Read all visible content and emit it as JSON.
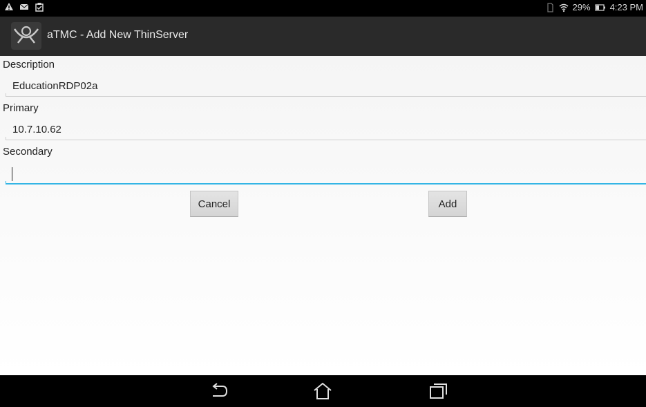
{
  "status_bar": {
    "left_icons": [
      "warning-icon",
      "mail-icon",
      "clipboard-icon"
    ],
    "right_icons": [
      "sim-icon",
      "wifi-icon",
      "battery-icon"
    ],
    "battery_percent": "29%",
    "time": "4:23 PM"
  },
  "action_bar": {
    "title": "aTMC - Add New ThinServer",
    "logo_icon": "atmc-logo-icon"
  },
  "form": {
    "description": {
      "label": "Description",
      "value": "EducationRDP02a"
    },
    "primary": {
      "label": "Primary",
      "value": "10.7.10.62"
    },
    "secondary": {
      "label": "Secondary",
      "value": ""
    }
  },
  "buttons": {
    "cancel": "Cancel",
    "add": "Add"
  },
  "nav_bar": {
    "icons": [
      "back-icon",
      "home-icon",
      "recent-apps-icon"
    ]
  },
  "colors": {
    "focus_accent": "#33b5e5",
    "action_bar_bg": "#2a2a2a"
  }
}
